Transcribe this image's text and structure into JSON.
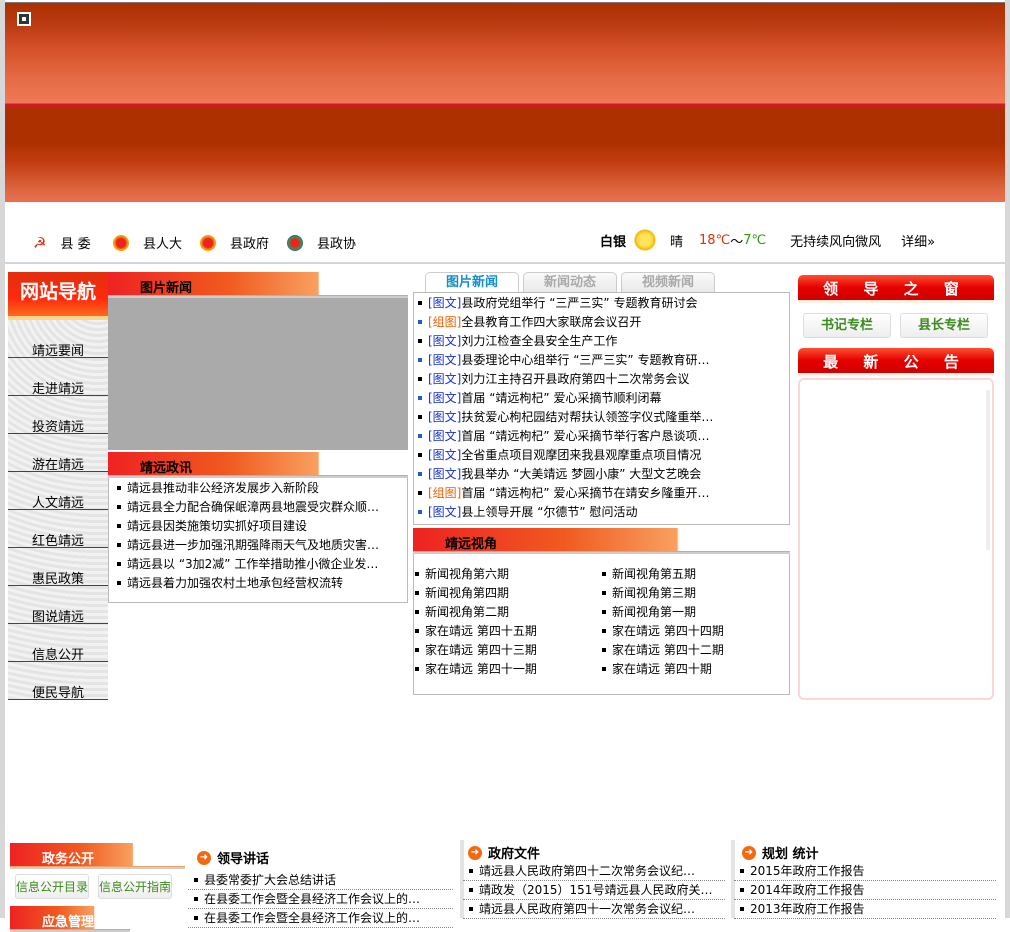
{
  "nav_sites": [
    "县 委",
    "县人大",
    "县政府",
    "县政协"
  ],
  "weather": {
    "city": "白银",
    "condition": "晴",
    "temp_high": "18℃",
    "sep": "～",
    "temp_low": "7℃",
    "wind": "无持续风向微风",
    "detail": "详细»"
  },
  "left_nav": {
    "title": "网站导航",
    "items": [
      "靖远要闻",
      "走进靖远",
      "投资靖远",
      "游在靖远",
      "人文靖远",
      "红色靖远",
      "惠民政策",
      "图说靖远",
      "信息公开",
      "便民导航"
    ]
  },
  "photo_news": {
    "title": "图片新闻"
  },
  "gov_news": {
    "title": "靖远政讯",
    "items": [
      "靖远县推动非公经济发展步入新阶段",
      "靖远县全力配合确保岷漳两县地震受灾群众顺…",
      "靖远县因类施策切实抓好项目建设",
      "靖远县进一步加强汛期强降雨天气及地质灾害…",
      "靖远县以 “3加2减” 工作举措助推小微企业发…",
      "靖远县着力加强农村土地承包经营权流转"
    ]
  },
  "tabs": [
    "图片新闻",
    "新闻动态",
    "视频新闻"
  ],
  "tab_news": [
    {
      "tag": "[图文]",
      "text": "县政府党组举行 “三严三实” 专题教育研讨会"
    },
    {
      "tag": "[组图]",
      "text": "全县教育工作四大家联席会议召开"
    },
    {
      "tag": "[图文]",
      "text": "刘力江检查全县安全生产工作"
    },
    {
      "tag": "[图文]",
      "text": "县委理论中心组举行 “三严三实” 专题教育研…"
    },
    {
      "tag": "[图文]",
      "text": "刘力江主持召开县政府第四十二次常务会议"
    },
    {
      "tag": "[图文]",
      "text": "首届 “靖远枸杞” 爱心采摘节顺利闭幕"
    },
    {
      "tag": "[图文]",
      "text": "扶贫爱心枸杞园结对帮扶认领签字仪式隆重举…"
    },
    {
      "tag": "[图文]",
      "text": "首届 “靖远枸杞” 爱心采摘节举行客户恳谈项…"
    },
    {
      "tag": "[图文]",
      "text": "全省重点项目观摩团来我县观摩重点项目情况"
    },
    {
      "tag": "[图文]",
      "text": "我县举办 “大美靖远 梦圆小康” 大型文艺晚会"
    },
    {
      "tag": "[组图]",
      "text": "首届 “靖远枸杞” 爱心采摘节在靖安乡隆重开…"
    },
    {
      "tag": "[图文]",
      "text": "县上领导开展 “尔德节” 慰问活动"
    }
  ],
  "perspective": {
    "title": "靖远视角",
    "items": [
      "新闻视角第六期",
      "新闻视角第五期",
      "新闻视角第四期",
      "新闻视角第三期",
      "新闻视角第二期",
      "新闻视角第一期",
      "家在靖远 第四十五期",
      "家在靖远 第四十四期",
      "家在靖远 第四十三期",
      "家在靖远 第四十二期",
      "家在靖远 第四十一期",
      "家在靖远 第四十期"
    ]
  },
  "leaders": {
    "title": "领 导 之 窗",
    "btn1": "书记专栏",
    "btn2": "县长专栏"
  },
  "notice": {
    "title": "最 新 公 告"
  },
  "bottom": {
    "gov_open": {
      "title": "政务公开",
      "btn1": "信息公开目录",
      "btn2": "信息公开指南",
      "next_title": "应急管理"
    },
    "speeches": {
      "title": "领导讲话",
      "items": [
        "县委常委扩大会总结讲话",
        "在县委工作会暨全县经济工作会议上的…",
        "在县委工作会暨全县经济工作会议上的…"
      ]
    },
    "gov_docs": {
      "title": "政府文件",
      "items": [
        "靖远县人民政府第四十二次常务会议纪…",
        "靖政发（2015）151号靖远县人民政府关…",
        "靖远县人民政府第四十一次常务会议纪…"
      ]
    },
    "planning": {
      "title": "规划 统计",
      "items": [
        "2015年政府工作报告",
        "2014年政府工作报告",
        "2013年政府工作报告"
      ]
    }
  },
  "colors": {
    "accent_red": "#e40000",
    "tag_blue": "#1530d0",
    "tag_orange": "#f06000",
    "temp_high": "#e03000",
    "temp_low": "#2a9a10",
    "green_btn": "#3c8a1e"
  }
}
